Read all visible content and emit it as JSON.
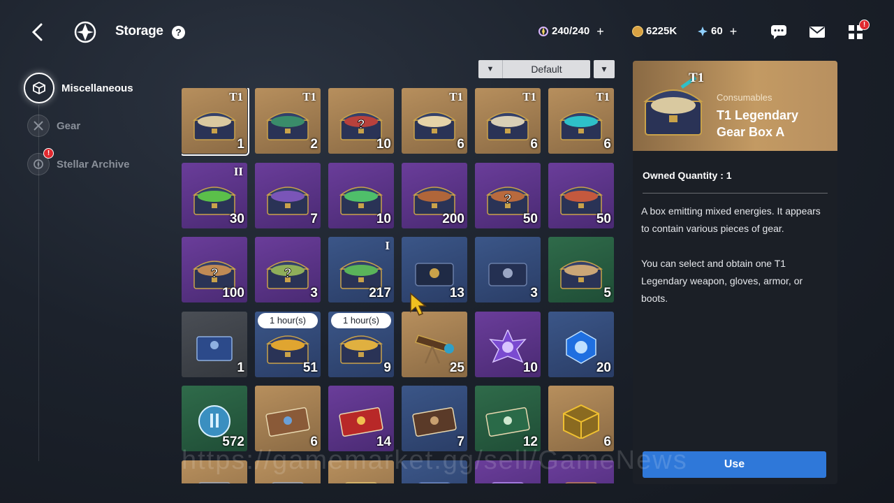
{
  "header": {
    "title": "Storage",
    "help": "?",
    "stamina": "240/240",
    "gold": "6225K",
    "crystal": "60",
    "plus": "+",
    "menu_badge": "!"
  },
  "sidebar": {
    "items": [
      {
        "label": "Miscellaneous"
      },
      {
        "label": "Gear"
      },
      {
        "label": "Stellar Archive",
        "badge": "!"
      }
    ]
  },
  "sort": {
    "label": "Default"
  },
  "items": [
    {
      "qty": "1",
      "tier": "T1",
      "rarity": "gold",
      "icon": "chest-icon",
      "chest": "#2a3356",
      "fill": "#d9c9a0"
    },
    {
      "qty": "2",
      "tier": "T1",
      "rarity": "gold",
      "icon": "chest-icon",
      "chest": "#2a3356",
      "fill": "#3a8c6a"
    },
    {
      "qty": "10",
      "tier": "",
      "rarity": "gold",
      "icon": "chest-icon",
      "chest": "#2a3356",
      "fill": "#b8413c",
      "mark": "?"
    },
    {
      "qty": "6",
      "tier": "T1",
      "rarity": "gold",
      "icon": "chest-icon",
      "chest": "#2a3356",
      "fill": "#e5d3a8"
    },
    {
      "qty": "6",
      "tier": "T1",
      "rarity": "gold",
      "icon": "chest-icon",
      "chest": "#2a3356",
      "fill": "#d8cfb6"
    },
    {
      "qty": "6",
      "tier": "T1",
      "rarity": "gold",
      "icon": "chest-icon",
      "chest": "#2a3356",
      "fill": "#2ec0c8"
    },
    {
      "qty": "30",
      "tier": "II",
      "rarity": "purple",
      "icon": "chest-icon",
      "chest": "#2a3356",
      "fill": "#5bbf4a"
    },
    {
      "qty": "7",
      "tier": "",
      "rarity": "purple",
      "icon": "chest-icon",
      "chest": "#2a3356",
      "fill": "#7a55b8"
    },
    {
      "qty": "10",
      "tier": "",
      "rarity": "purple",
      "icon": "chest-icon",
      "chest": "#2a3356",
      "fill": "#4fbf6a"
    },
    {
      "qty": "200",
      "tier": "",
      "rarity": "purple",
      "icon": "chest-icon",
      "chest": "#2a3356",
      "fill": "#b0663a"
    },
    {
      "qty": "50",
      "tier": "",
      "rarity": "purple",
      "icon": "chest-icon",
      "chest": "#2a3356",
      "fill": "#b86a3e",
      "mark": "?"
    },
    {
      "qty": "50",
      "tier": "",
      "rarity": "purple",
      "icon": "chest-icon",
      "chest": "#2a3356",
      "fill": "#c4593e"
    },
    {
      "qty": "100",
      "tier": "",
      "rarity": "purple",
      "icon": "chest-icon",
      "chest": "#2a3356",
      "fill": "#c08a55",
      "mark": "?"
    },
    {
      "qty": "3",
      "tier": "",
      "rarity": "purple",
      "icon": "chest-icon",
      "chest": "#2a3356",
      "fill": "#8fae5a",
      "mark": "?"
    },
    {
      "qty": "217",
      "tier": "I",
      "rarity": "blue",
      "icon": "chest-icon",
      "chest": "#2a3356",
      "fill": "#5ab35a"
    },
    {
      "qty": "13",
      "tier": "",
      "rarity": "blue",
      "icon": "case-icon",
      "chest": "#1f2a45",
      "fill": "#c9a24a"
    },
    {
      "qty": "3",
      "tier": "",
      "rarity": "blue",
      "icon": "case-icon",
      "chest": "#243052",
      "fill": "#9aa6c4"
    },
    {
      "qty": "5",
      "tier": "",
      "rarity": "green",
      "icon": "chest-icon",
      "chest": "#2a3356",
      "fill": "#cba677"
    },
    {
      "qty": "1",
      "tier": "",
      "rarity": "gray",
      "icon": "gift-box-icon",
      "chest": "#2c4a8a",
      "fill": "#8fb0e0"
    },
    {
      "qty": "51",
      "tier": "",
      "rarity": "blue",
      "icon": "chest-icon",
      "chest": "#2a3356",
      "fill": "#e0a530",
      "timer": "1 hour(s)"
    },
    {
      "qty": "9",
      "tier": "",
      "rarity": "blue",
      "icon": "chest-icon",
      "chest": "#2a3356",
      "fill": "#e0b040",
      "timer": "1 hour(s)"
    },
    {
      "qty": "25",
      "tier": "",
      "rarity": "gold",
      "icon": "telescope-icon",
      "chest": "#5a3a20",
      "fill": "#2fa0c8"
    },
    {
      "qty": "10",
      "tier": "",
      "rarity": "purple",
      "icon": "crystal-star-icon",
      "chest": "#7a4ad0",
      "fill": "#d8c4ff"
    },
    {
      "qty": "20",
      "tier": "",
      "rarity": "blue",
      "icon": "crystal-gem-icon",
      "chest": "#1f6fe0",
      "fill": "#bfe0ff"
    },
    {
      "qty": "572",
      "tier": "",
      "rarity": "green",
      "icon": "orb-icon",
      "chest": "#3a8fc0",
      "fill": "#d8f0ff"
    },
    {
      "qty": "6",
      "tier": "",
      "rarity": "gold",
      "icon": "ticket-icon",
      "chest": "#8a5a38",
      "fill": "#6aa0d8"
    },
    {
      "qty": "14",
      "tier": "",
      "rarity": "purple",
      "icon": "ticket-icon",
      "chest": "#b82828",
      "fill": "#f0c050"
    },
    {
      "qty": "7",
      "tier": "",
      "rarity": "blue",
      "icon": "ticket-icon",
      "chest": "#5a3a28",
      "fill": "#c8a070"
    },
    {
      "qty": "12",
      "tier": "",
      "rarity": "green",
      "icon": "ticket-icon",
      "chest": "#2a6a48",
      "fill": "#d0e8d0"
    },
    {
      "qty": "6",
      "tier": "",
      "rarity": "gold",
      "icon": "cube-icon",
      "chest": "#8a6a20",
      "fill": "#f0c030"
    },
    {
      "qty": "",
      "tier": "",
      "rarity": "gold",
      "icon": "item-icon",
      "chest": "#3a3e48",
      "fill": "#aab0bc"
    },
    {
      "qty": "",
      "tier": "",
      "rarity": "gold",
      "icon": "item-icon",
      "chest": "#3a3e48",
      "fill": "#aab0bc"
    },
    {
      "qty": "",
      "tier": "",
      "rarity": "gold",
      "icon": "item-icon",
      "chest": "#b89050",
      "fill": "#e0c070"
    },
    {
      "qty": "",
      "tier": "",
      "rarity": "blue",
      "icon": "item-icon",
      "chest": "#d8dde6",
      "fill": "#5a78b8"
    },
    {
      "qty": "",
      "tier": "",
      "rarity": "purple",
      "icon": "item-icon",
      "chest": "#6a38c8",
      "fill": "#b890f0"
    },
    {
      "qty": "",
      "tier": "",
      "rarity": "purple",
      "icon": "item-icon",
      "chest": "#6a3a30",
      "fill": "#c08060"
    }
  ],
  "detail": {
    "tier": "T1",
    "category": "Consumables",
    "name": "T1 Legendary Gear Box A",
    "owned": "Owned Quantity : 1",
    "desc1": "A box emitting mixed energies. It appears to contain various pieces of gear.",
    "desc2": "You can select and obtain one T1 Legendary weapon, gloves, armor, or boots.",
    "use_label": "Use"
  },
  "watermark": "https://gamemarket.gg/sell/GameNews",
  "colors": {
    "accent": "#2f78d9",
    "badge": "#e0282e"
  }
}
